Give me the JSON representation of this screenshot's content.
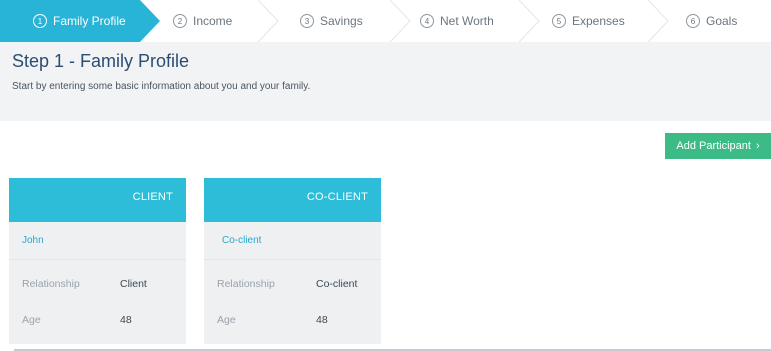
{
  "colors": {
    "active_step": "#28b4d6",
    "card_header": "#2ebdd9",
    "add_button": "#3dbb86",
    "title": "#2c4d72",
    "link": "#2aa7cc"
  },
  "steps": [
    {
      "num": "1",
      "label": "Family Profile"
    },
    {
      "num": "2",
      "label": "Income"
    },
    {
      "num": "3",
      "label": "Savings"
    },
    {
      "num": "4",
      "label": "Net Worth"
    },
    {
      "num": "5",
      "label": "Expenses"
    },
    {
      "num": "6",
      "label": "Goals"
    }
  ],
  "header": {
    "title": "Step 1 - Family Profile",
    "subtitle": "Start by entering some basic information about you and your family."
  },
  "add_participant": {
    "label": "Add Participant",
    "icon": "chevron-right-icon",
    "glyph": "›"
  },
  "cards": [
    {
      "role": "CLIENT",
      "name": "John",
      "relationship_label": "Relationship",
      "relationship_value": "Client",
      "age_label": "Age",
      "age_value": "48"
    },
    {
      "role": "CO-CLIENT",
      "name": "Co-client",
      "relationship_label": "Relationship",
      "relationship_value": "Co-client",
      "age_label": "Age",
      "age_value": "48"
    }
  ]
}
